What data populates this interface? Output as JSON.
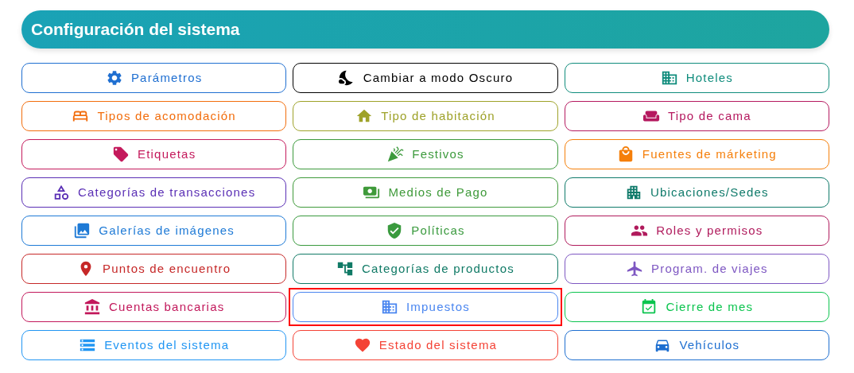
{
  "header": {
    "title": "Configuración del sistema"
  },
  "items": [
    {
      "label": "Parámetros",
      "color": "#1f6fd1",
      "highlighted": false
    },
    {
      "label": "Cambiar a modo Oscuro",
      "color": "#000000",
      "highlighted": false
    },
    {
      "label": "Hoteles",
      "color": "#0f8c7c",
      "highlighted": false
    },
    {
      "label": "Tipos de acomodación",
      "color": "#f26d0c",
      "highlighted": false
    },
    {
      "label": "Tipo de habitación",
      "color": "#9ea229",
      "highlighted": false
    },
    {
      "label": "Tipo de cama",
      "color": "#b5195f",
      "highlighted": false
    },
    {
      "label": "Etiquetas",
      "color": "#c41a5c",
      "highlighted": false
    },
    {
      "label": "Festivos",
      "color": "#3c9a3c",
      "highlighted": false
    },
    {
      "label": "Fuentes de márketing",
      "color": "#f57f0a",
      "highlighted": false
    },
    {
      "label": "Categorías de transacciones",
      "color": "#5a2fb5",
      "highlighted": false
    },
    {
      "label": "Medios de Pago",
      "color": "#3f9a3a",
      "highlighted": false
    },
    {
      "label": "Ubicaciones/Sedes",
      "color": "#0f7a6a",
      "highlighted": false
    },
    {
      "label": "Galerías de imágenes",
      "color": "#1e7ad6",
      "highlighted": false
    },
    {
      "label": "Políticas",
      "color": "#3a9a3e",
      "highlighted": false
    },
    {
      "label": "Roles y permisos",
      "color": "#b01a5c",
      "highlighted": false
    },
    {
      "label": "Puntos de encuentro",
      "color": "#c62828",
      "highlighted": false
    },
    {
      "label": "Categorías de productos",
      "color": "#107a66",
      "highlighted": false
    },
    {
      "label": "Program. de viajes",
      "color": "#7e57c2",
      "highlighted": false
    },
    {
      "label": "Cuentas bancarias",
      "color": "#c2185b",
      "highlighted": false
    },
    {
      "label": "Impuestos",
      "color": "#4a86f0",
      "highlighted": true
    },
    {
      "label": "Cierre de mes",
      "color": "#0bc44e",
      "highlighted": false
    },
    {
      "label": "Eventos del sistema",
      "color": "#2196f3",
      "highlighted": false
    },
    {
      "label": "Estado del sistema",
      "color": "#f44336",
      "highlighted": false
    },
    {
      "label": "Vehículos",
      "color": "#1e6fd0",
      "highlighted": false
    }
  ]
}
